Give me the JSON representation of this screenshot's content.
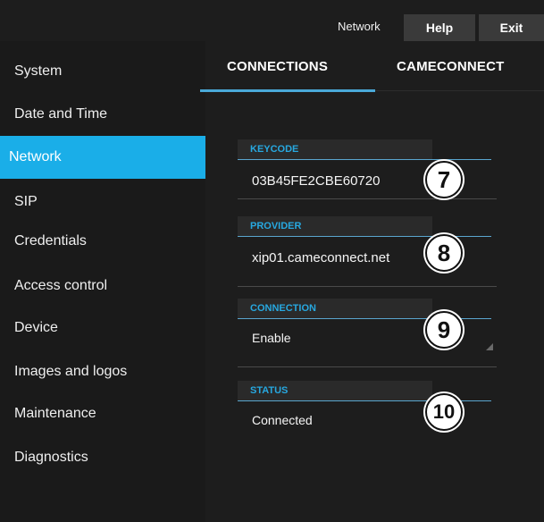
{
  "header": {
    "breadcrumb": "Network",
    "help_label": "Help",
    "exit_label": "Exit"
  },
  "sidebar": {
    "items": [
      {
        "label": "System"
      },
      {
        "label": "Date and Time"
      },
      {
        "label": "Network",
        "active": true
      },
      {
        "label": "SIP"
      },
      {
        "label": "Credentials"
      },
      {
        "label": "Access control"
      },
      {
        "label": "Device"
      },
      {
        "label": "Images and logos"
      },
      {
        "label": "Maintenance"
      },
      {
        "label": "Diagnostics"
      }
    ]
  },
  "tabs": [
    {
      "label": "CONNECTIONS",
      "active": true
    },
    {
      "label": "CAMECONNECT",
      "active": false
    }
  ],
  "fields": {
    "keycode": {
      "label": "KEYCODE",
      "value": "03B45FE2CBE60720",
      "callout": "7"
    },
    "provider": {
      "label": "PROVIDER",
      "value": "xip01.cameconnect.net",
      "callout": "8"
    },
    "connection": {
      "label": "CONNECTION",
      "value": "Enable",
      "callout": "9"
    },
    "status": {
      "label": "STATUS",
      "value": "Connected",
      "callout": "10"
    }
  },
  "colors": {
    "accent": "#1aaee8",
    "background": "#1d1d1d",
    "label_blue": "#27a8e0"
  }
}
